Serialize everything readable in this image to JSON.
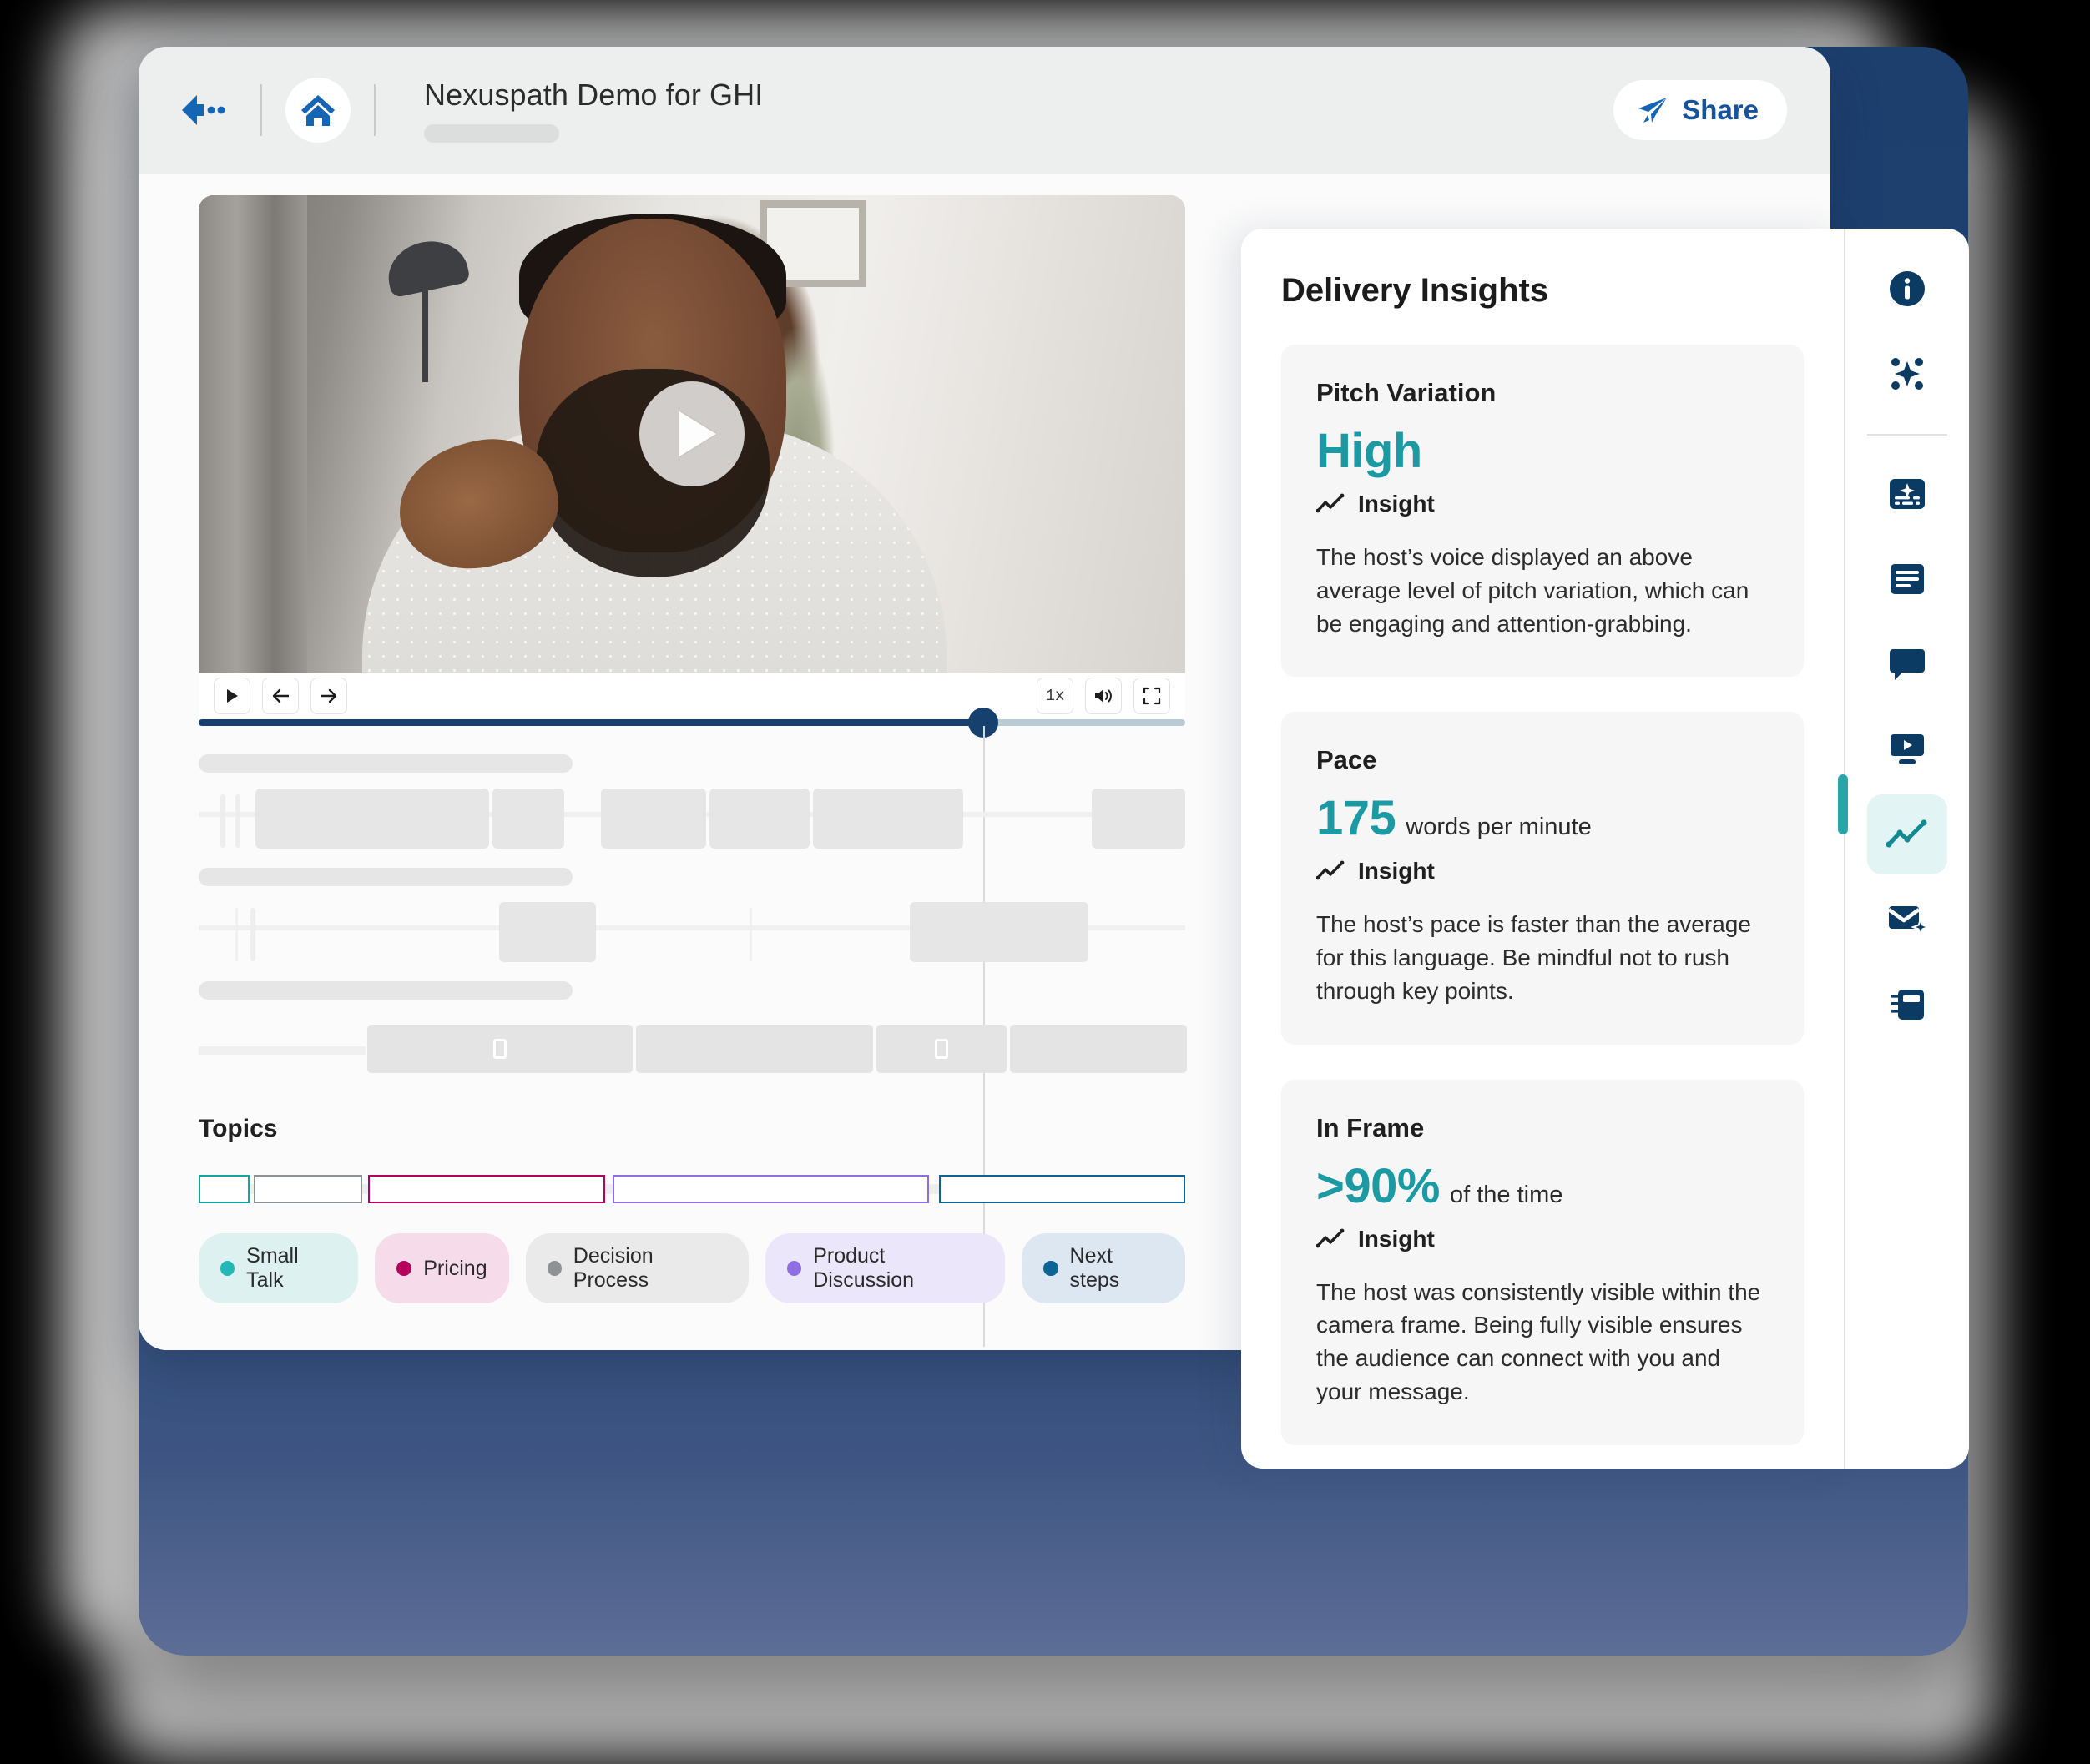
{
  "window": {
    "title": "Nexuspath Demo for GHI",
    "back_icon": "back-arrow-icon",
    "home_icon": "home-icon",
    "share_label": "Share",
    "share_icon": "paper-plane-icon"
  },
  "player": {
    "play_overlay_icon": "play-icon",
    "controls": [
      {
        "name": "play-button",
        "icon": "play-icon"
      },
      {
        "name": "step-back-button",
        "icon": "arrow-left-icon"
      },
      {
        "name": "step-forward-button",
        "icon": "arrow-right-icon"
      }
    ],
    "speed_label": "1x",
    "volume_icon": "volume-icon",
    "fullscreen_icon": "fullscreen-icon",
    "progress_percent": 79.5
  },
  "topics": {
    "heading": "Topics",
    "segments": [
      {
        "label": "Small Talk",
        "left_pct": 0.0,
        "width_pct": 5.2,
        "color": "#0fa5a5"
      },
      {
        "label": "Decision Process",
        "left_pct": 5.6,
        "width_pct": 11.0,
        "color": "#8f9295"
      },
      {
        "label": "Pricing",
        "left_pct": 17.2,
        "width_pct": 24.0,
        "color": "#b6005e"
      },
      {
        "label": "Product Discussion",
        "left_pct": 42.0,
        "width_pct": 32.0,
        "color": "#8e6ee0"
      },
      {
        "label": "Next steps",
        "left_pct": 75.0,
        "width_pct": 25.0,
        "color": "#0c6596"
      }
    ],
    "legend": [
      {
        "label": "Small Talk",
        "dot": "#25b6b6",
        "bg": "#ddf1f1"
      },
      {
        "label": "Pricing",
        "dot": "#b6005e",
        "bg": "#f6dcea"
      },
      {
        "label": "Decision Process",
        "dot": "#8f9295",
        "bg": "#eaeaea"
      },
      {
        "label": "Product Discussion",
        "dot": "#8e6ee0",
        "bg": "#ebe6fa"
      },
      {
        "label": "Next steps",
        "dot": "#0c6596",
        "bg": "#dde7f1"
      }
    ]
  },
  "insights": {
    "panel_title": "Delivery Insights",
    "insight_label": "Insight",
    "insight_icon": "trend-line-icon",
    "accent_color": "#1c9aa3",
    "cards": [
      {
        "title": "Pitch Variation",
        "value": "High",
        "unit": "",
        "body": "The host’s voice displayed an above average level of pitch variation, which can be engaging and attention-grabbing."
      },
      {
        "title": "Pace",
        "value": "175",
        "unit": "words per minute",
        "body": "The host’s pace is faster than the average for this language. Be mindful not to rush through key points."
      },
      {
        "title": "In Frame",
        "value": ">90%",
        "unit": "of the time",
        "body": "The host was consistently visible within the camera frame. Being fully visible ensures the audience can connect with you and your message."
      }
    ]
  },
  "rail": {
    "items": [
      {
        "name": "rail-info",
        "icon": "info-circle-icon",
        "active": false
      },
      {
        "name": "rail-ai-sparkle",
        "icon": "sparkle-icon",
        "active": false
      },
      {
        "name": "rail-ai-summary",
        "icon": "ai-summary-icon",
        "active": false
      },
      {
        "name": "rail-transcript",
        "icon": "document-lines-icon",
        "active": false
      },
      {
        "name": "rail-comments",
        "icon": "comment-bubble-icon",
        "active": false
      },
      {
        "name": "rail-clips",
        "icon": "video-play-icon",
        "active": false
      },
      {
        "name": "rail-insights",
        "icon": "trend-line-icon",
        "active": true
      },
      {
        "name": "rail-email",
        "icon": "envelope-sparkle-icon",
        "active": false
      },
      {
        "name": "rail-notes",
        "icon": "notebook-icon",
        "active": false
      }
    ]
  }
}
